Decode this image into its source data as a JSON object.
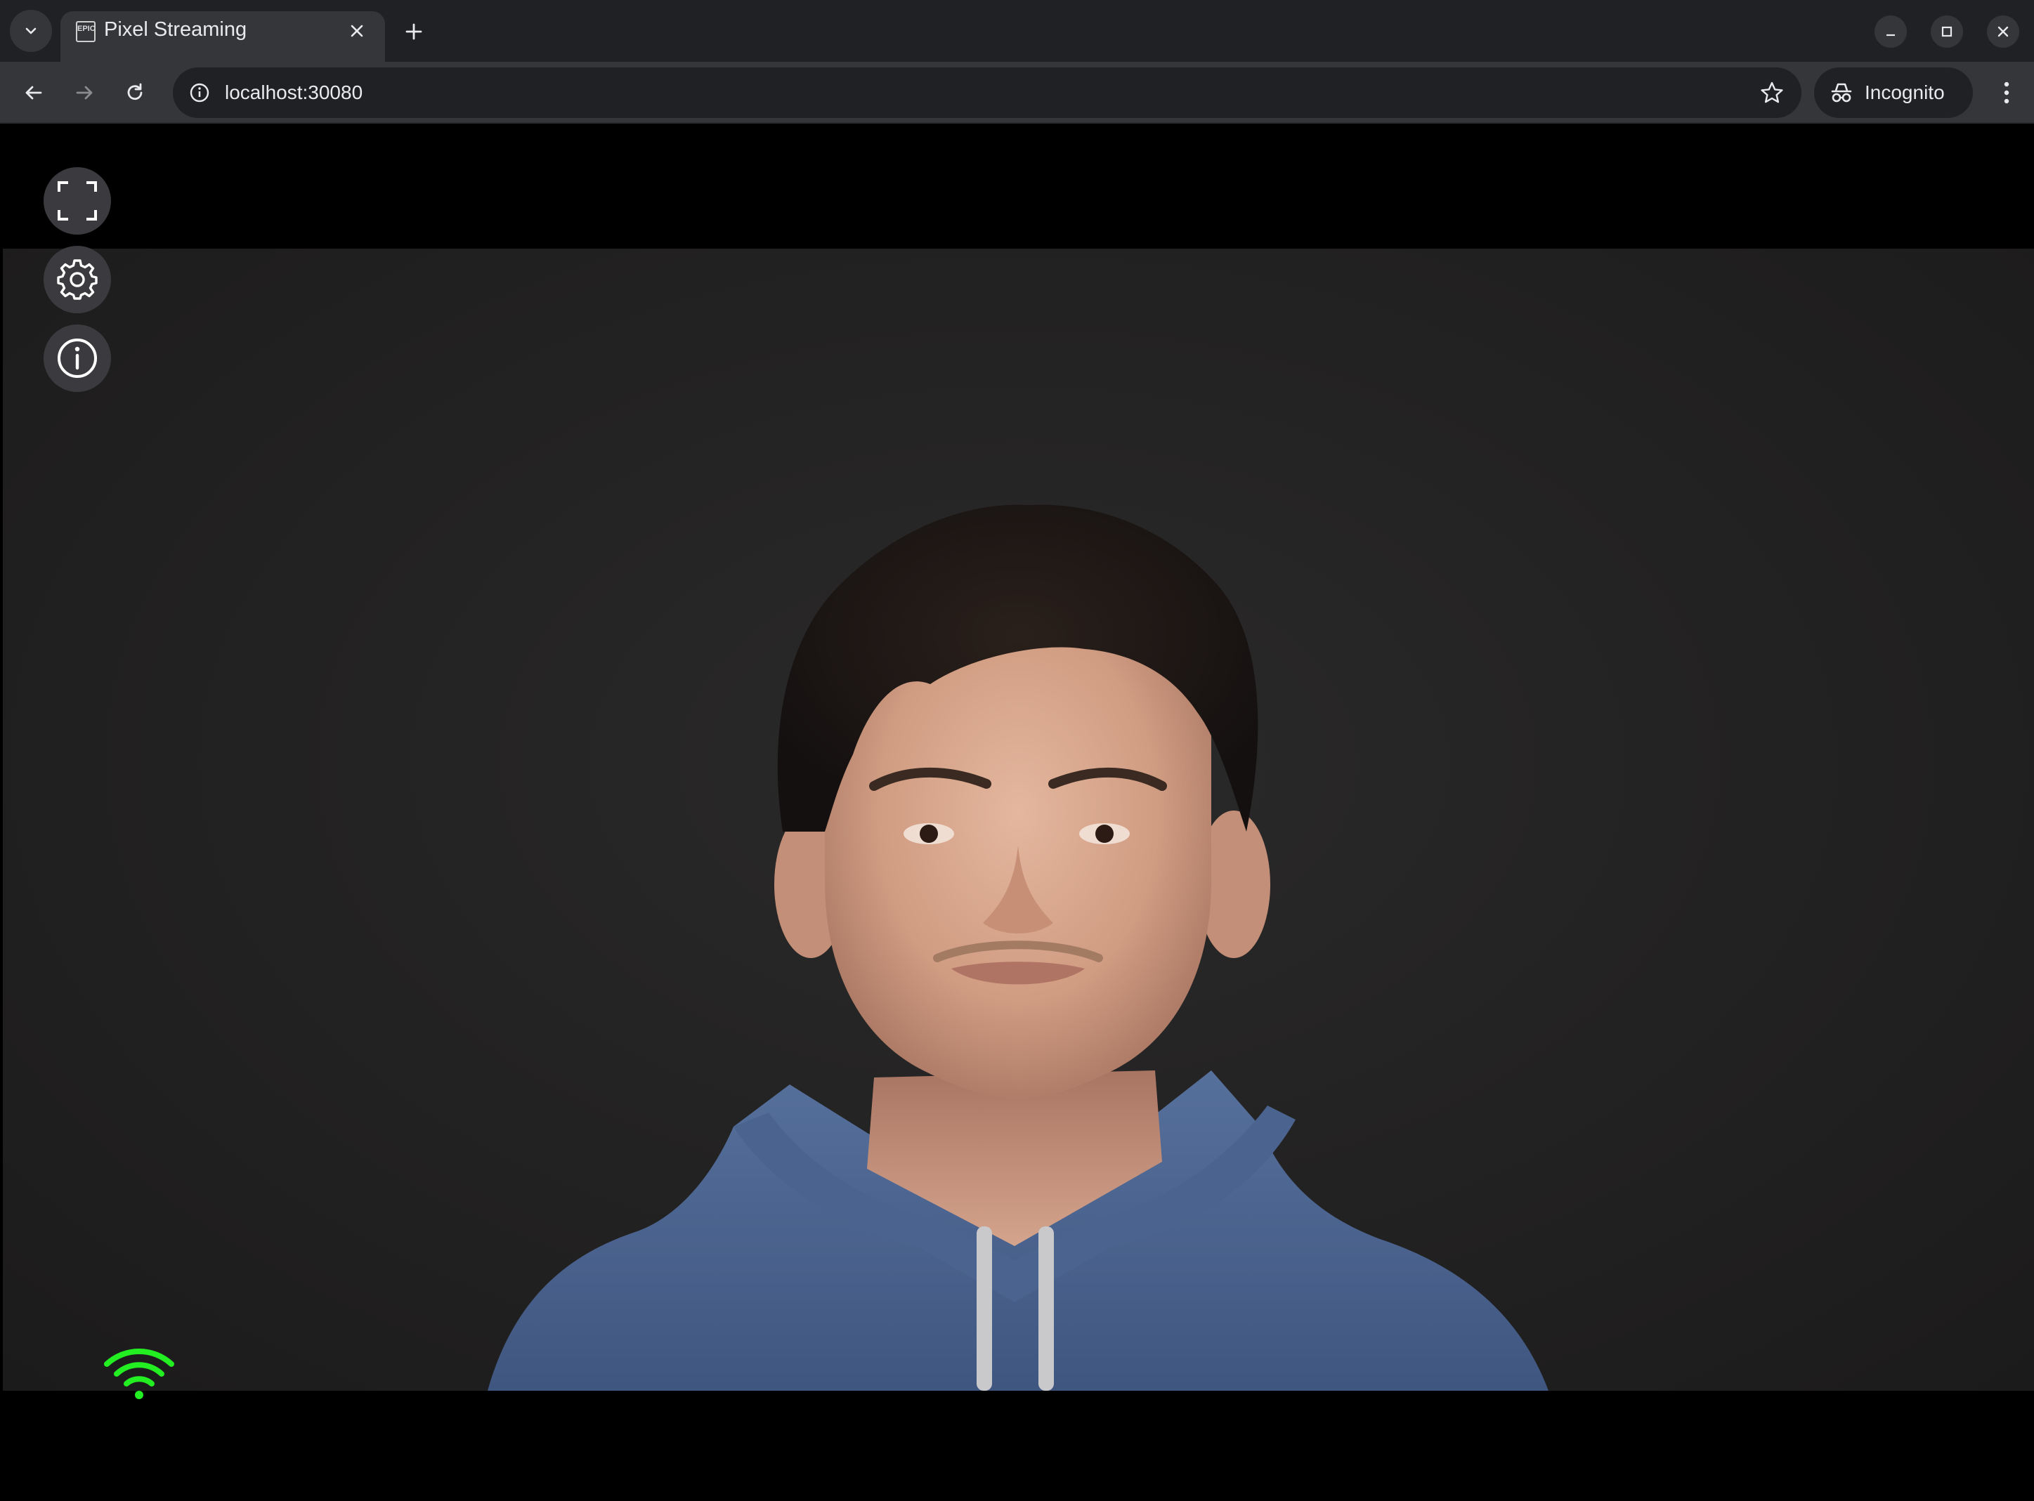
{
  "browser": {
    "tab": {
      "title": "Pixel Streaming",
      "favicon_text": "EPIC",
      "favicon": "epic-games-icon"
    },
    "address_bar": {
      "url": "localhost:30080"
    },
    "profile": {
      "label": "Incognito",
      "icon": "incognito-icon"
    },
    "icons": {
      "tab_list": "chevron-down-icon",
      "tab_close": "close-icon",
      "new_tab": "plus-icon",
      "minimize": "minimize-icon",
      "maximize": "maximize-icon",
      "close": "close-icon",
      "back": "arrow-back-icon",
      "forward": "arrow-forward-icon",
      "reload": "reload-icon",
      "site_info": "info-circle-icon",
      "bookmark": "star-icon",
      "menu": "kebab-menu-icon"
    }
  },
  "player": {
    "controls": [
      {
        "id": "fullscreen",
        "icon": "fullscreen-icon"
      },
      {
        "id": "settings",
        "icon": "gear-icon"
      },
      {
        "id": "info",
        "icon": "info-icon"
      }
    ],
    "connection": {
      "icon": "wifi-icon",
      "status_color": "#22ee22",
      "strength_bars": 4
    },
    "stream": {
      "subject": "avatar-video",
      "background_color": "#242323",
      "hoodie_color": "#4a6290"
    }
  },
  "colors": {
    "tabbar_bg": "#202124",
    "toolbar_bg": "#35363a",
    "control_bg": "#3b3b3f"
  }
}
